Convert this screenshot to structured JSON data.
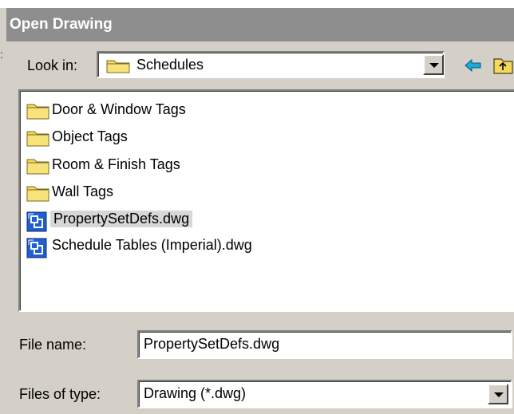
{
  "window": {
    "title": "Open Drawing"
  },
  "lookin": {
    "label": "Look in:",
    "value": "Schedules",
    "icon": "folder-icon"
  },
  "nav": {
    "back_icon": "back-arrow-icon",
    "up_icon": "up-folder-icon"
  },
  "files": [
    {
      "name": "Door & Window Tags",
      "type": "folder",
      "selected": false
    },
    {
      "name": "Object Tags",
      "type": "folder",
      "selected": false
    },
    {
      "name": "Room & Finish Tags",
      "type": "folder",
      "selected": false
    },
    {
      "name": "Wall Tags",
      "type": "folder",
      "selected": false
    },
    {
      "name": "PropertySetDefs.dwg",
      "type": "dwg",
      "selected": true
    },
    {
      "name": "Schedule Tables (Imperial).dwg",
      "type": "dwg",
      "selected": false
    }
  ],
  "filename": {
    "label": "File name:",
    "value": "PropertySetDefs.dwg"
  },
  "filetype": {
    "label": "Files of type:",
    "value": "Drawing (*.dwg)"
  },
  "colors": {
    "folder": "#f5d95a",
    "dwg_icon": "#1f5fd0",
    "selection": "#d7d7d7",
    "titlebar": "#8e8e8e"
  }
}
